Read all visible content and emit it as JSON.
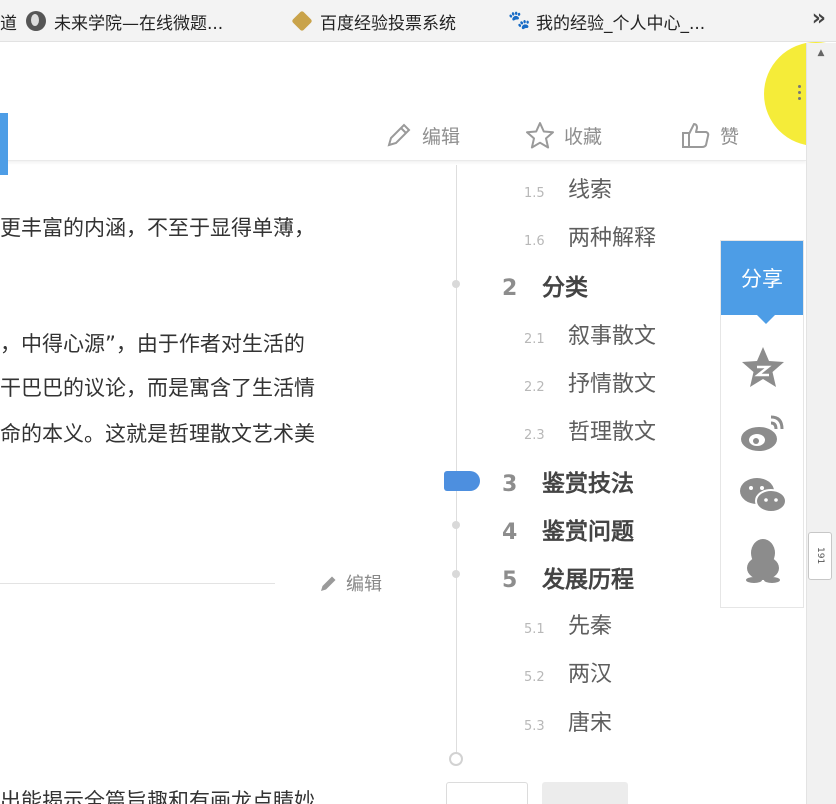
{
  "bookmarks": {
    "items": [
      {
        "label": "未来学院—在线微题...",
        "icon": "globe-icon"
      },
      {
        "label": "百度经验投票系统",
        "icon": "graduation-hat-icon"
      },
      {
        "label": "我的经验_个人中心_...",
        "icon": "baidu-paw-icon"
      }
    ],
    "partial_left": "道",
    "overflow": "»"
  },
  "header": {
    "edit_label": "编辑",
    "favorite_label": "收藏",
    "like_label": "赞"
  },
  "article": {
    "lines": [
      "更丰富的内涵，不至于显得单薄，",
      "，中得心源”，由于作者对生活的",
      "干巴巴的议论，而是寓含了生活情",
      "命的本义。这就是哲理散文艺术美"
    ],
    "edit_label": "编辑",
    "bottom_line": "出能揭示全篇旨趣和有画龙点睛妙"
  },
  "toc": {
    "items": [
      {
        "num": "1.5",
        "label": "线索",
        "level": 2
      },
      {
        "num": "1.6",
        "label": "两种解释",
        "level": 2
      },
      {
        "num": "2",
        "label": "分类",
        "level": 1
      },
      {
        "num": "2.1",
        "label": "叙事散文",
        "level": 2
      },
      {
        "num": "2.2",
        "label": "抒情散文",
        "level": 2
      },
      {
        "num": "2.3",
        "label": "哲理散文",
        "level": 2
      },
      {
        "num": "3",
        "label": "鉴赏技法",
        "level": 1,
        "active": true
      },
      {
        "num": "4",
        "label": "鉴赏问题",
        "level": 1
      },
      {
        "num": "5",
        "label": "发展历程",
        "level": 1
      },
      {
        "num": "5.1",
        "label": "先秦",
        "level": 2
      },
      {
        "num": "5.2",
        "label": "两汉",
        "level": 2
      },
      {
        "num": "5.3",
        "label": "唐宋",
        "level": 2
      }
    ]
  },
  "share": {
    "title": "分享",
    "icons": [
      "qzone-star-icon",
      "weibo-icon",
      "wechat-icon",
      "qq-penguin-icon"
    ],
    "accent": "#4d9de6"
  },
  "scrollbar": {
    "thumb_label": "191"
  },
  "colors": {
    "accent": "#4d9de6",
    "marker": "#4d8fdf",
    "highlight": "#f4e91e"
  }
}
